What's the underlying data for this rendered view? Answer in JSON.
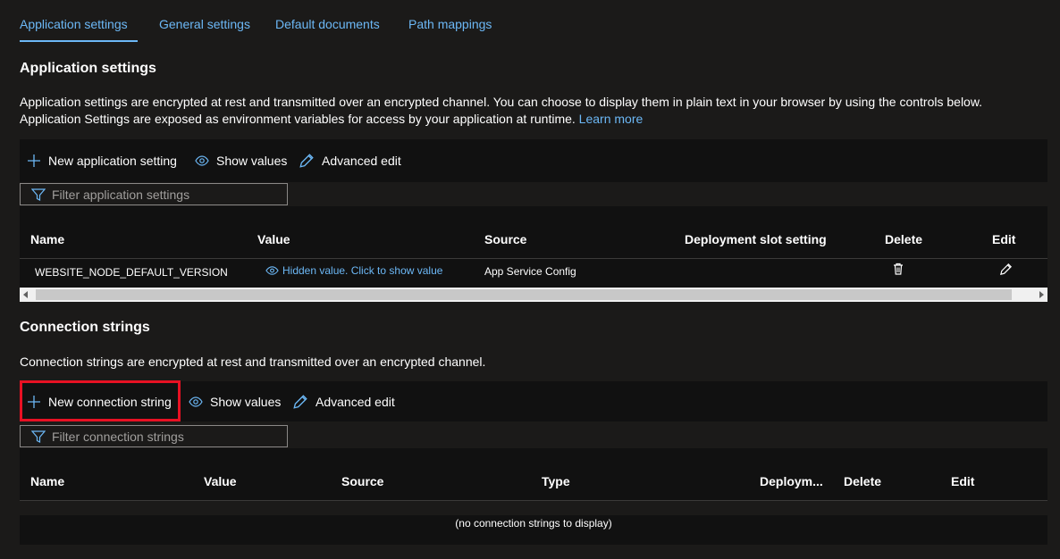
{
  "tabs": [
    {
      "label": "Application settings",
      "active": true
    },
    {
      "label": "General settings",
      "active": false
    },
    {
      "label": "Default documents",
      "active": false
    },
    {
      "label": "Path mappings",
      "active": false
    }
  ],
  "app_settings": {
    "heading": "Application settings",
    "description_line1": "Application settings are encrypted at rest and transmitted over an encrypted channel. You can choose to display them in plain text in your browser by using the controls below.",
    "description_line2": "Application Settings are exposed as environment variables for access by your application at runtime.",
    "learn_more": "Learn more",
    "toolbar": {
      "new_label": "New application setting",
      "show_values_label": "Show values",
      "advanced_edit_label": "Advanced edit"
    },
    "filter_placeholder": "Filter application settings",
    "columns": [
      "Name",
      "Value",
      "Source",
      "Deployment slot setting",
      "Delete",
      "Edit"
    ],
    "rows": [
      {
        "name": "WEBSITE_NODE_DEFAULT_VERSION",
        "value": "Hidden value. Click to show value",
        "source": "App Service Config"
      }
    ]
  },
  "connection_strings": {
    "heading": "Connection strings",
    "description": "Connection strings are encrypted at rest and transmitted over an encrypted channel.",
    "toolbar": {
      "new_label": "New connection string",
      "show_values_label": "Show values",
      "advanced_edit_label": "Advanced edit"
    },
    "filter_placeholder": "Filter connection strings",
    "columns": [
      "Name",
      "Value",
      "Source",
      "Type",
      "Deploym...",
      "Delete",
      "Edit"
    ],
    "empty_message": "(no connection strings to display)"
  },
  "colors": {
    "accent": "#6cb8f6",
    "background": "#1b1a19",
    "highlight": "#e81123"
  },
  "icons": [
    "plus-icon",
    "eye-icon",
    "pencil-icon",
    "filter-icon",
    "trash-icon",
    "edit-icon"
  ]
}
